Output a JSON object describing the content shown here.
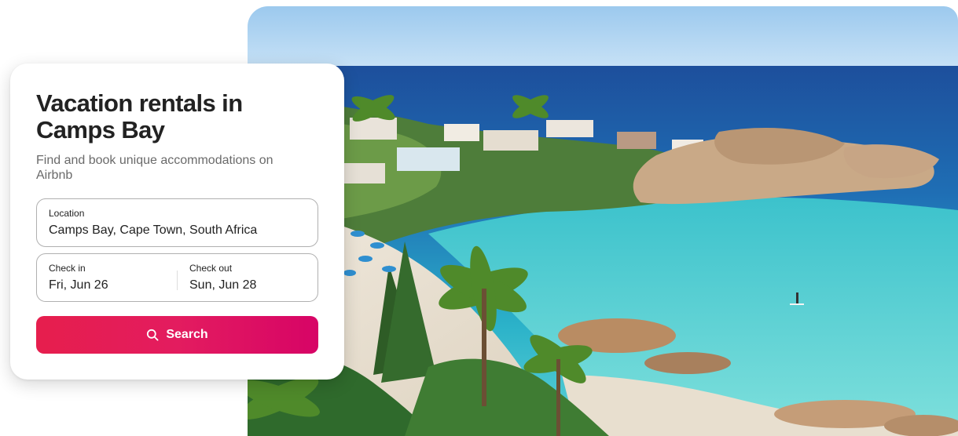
{
  "hero": {
    "icon": "beach-photo"
  },
  "card": {
    "title": "Vacation rentals in Camps Bay",
    "subtitle": "Find and book unique accommodations on Airbnb"
  },
  "location": {
    "label": "Location",
    "value": "Camps Bay, Cape Town, South Africa"
  },
  "dates": {
    "checkin_label": "Check in",
    "checkin_value": "Fri, Jun 26",
    "checkout_label": "Check out",
    "checkout_value": "Sun, Jun 28"
  },
  "search": {
    "label": "Search",
    "icon": "search-icon"
  },
  "colors": {
    "brand_start": "#e61e4d",
    "brand_end": "#d70466",
    "text_primary": "#222222",
    "text_secondary": "#6a6a6a",
    "border": "#b0b0b0"
  }
}
